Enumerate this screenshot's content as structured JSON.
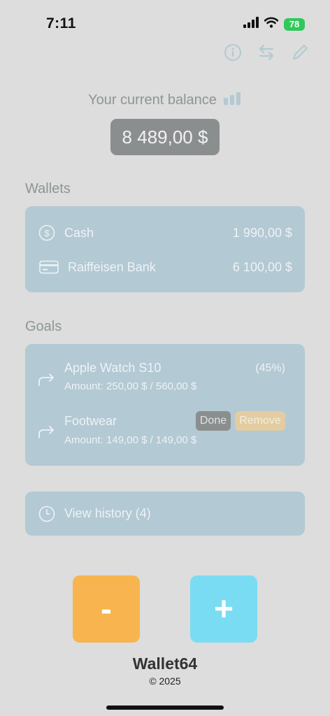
{
  "status": {
    "time": "7:11",
    "battery": "78"
  },
  "toolbar": {
    "info_icon": "info-icon",
    "swap_icon": "swap-arrows-icon",
    "edit_icon": "pencil-icon"
  },
  "balance": {
    "label": "Your current balance",
    "value": "8 489,00 $"
  },
  "wallets": {
    "title": "Wallets",
    "items": [
      {
        "icon": "dollar-circle-icon",
        "name": "Cash",
        "amount": "1 990,00 $"
      },
      {
        "icon": "credit-card-icon",
        "name": "Raiffeisen Bank",
        "amount": "6 100,00 $"
      }
    ]
  },
  "goals": {
    "title": "Goals",
    "items": [
      {
        "icon": "share-arrow-icon",
        "name": "Apple Watch S10",
        "amount": "Amount: 250,00 $ / 560,00 $",
        "progress": "(45%)"
      },
      {
        "icon": "share-arrow-icon",
        "name": "Footwear",
        "amount": "Amount: 149,00 $ / 149,00 $",
        "done_label": "Done",
        "remove_label": "Remove"
      }
    ]
  },
  "history": {
    "label": "View history (4)",
    "icon": "clock-icon"
  },
  "actions": {
    "minus_label": "-",
    "plus_label": "+"
  },
  "footer": {
    "app_name": "Wallet64",
    "copyright": "© 2025"
  },
  "colors": {
    "background": "#dcdddc",
    "card": "#b3c9d4",
    "minus": "#f7b44f",
    "plus": "#7adcf2",
    "remove": "#e3cda0",
    "battery": "#30c85a"
  }
}
